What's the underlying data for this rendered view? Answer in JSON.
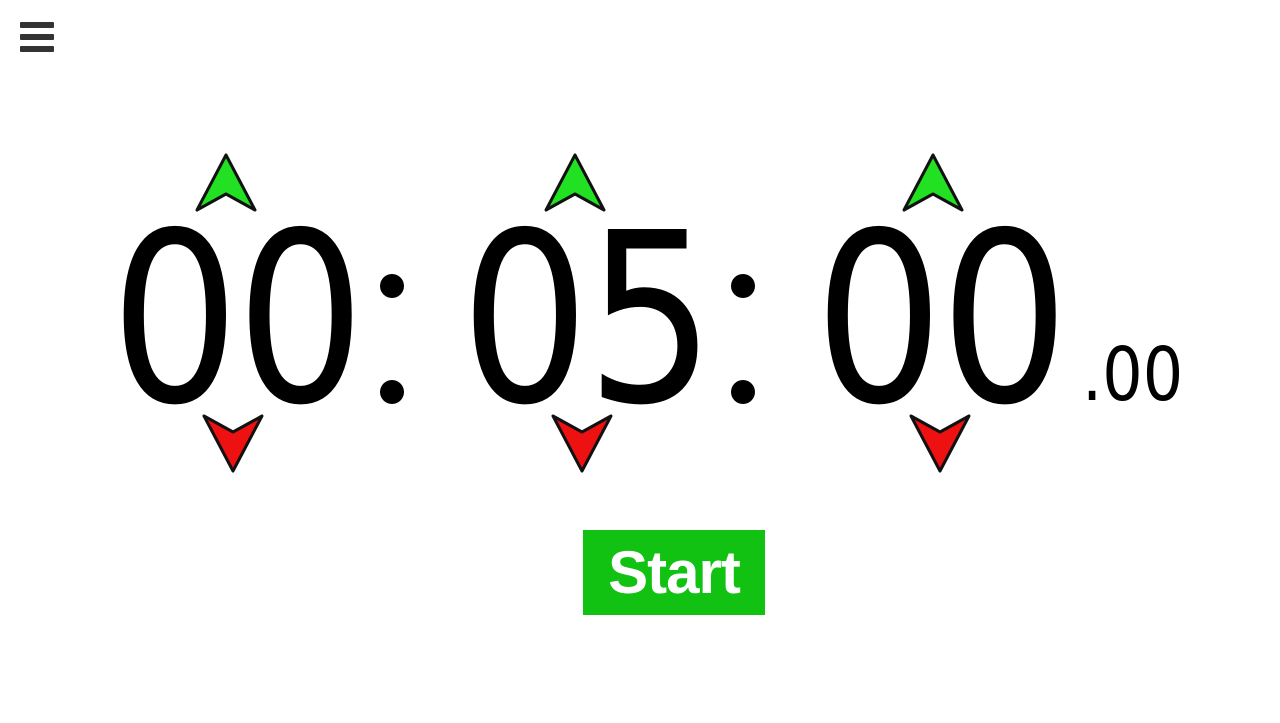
{
  "timer": {
    "hours": "00",
    "minutes": "05",
    "seconds": "00",
    "fraction": ".00",
    "separator": ":"
  },
  "controls": {
    "start_label": "Start"
  },
  "icons": {
    "menu": "hamburger-menu-icon",
    "increment": "arrow-up-icon",
    "decrement": "arrow-down-icon"
  },
  "colors": {
    "increment_arrow": "#22e022",
    "decrement_arrow": "#ee1111",
    "start_button": "#12c212",
    "menu_icon": "#333333"
  }
}
